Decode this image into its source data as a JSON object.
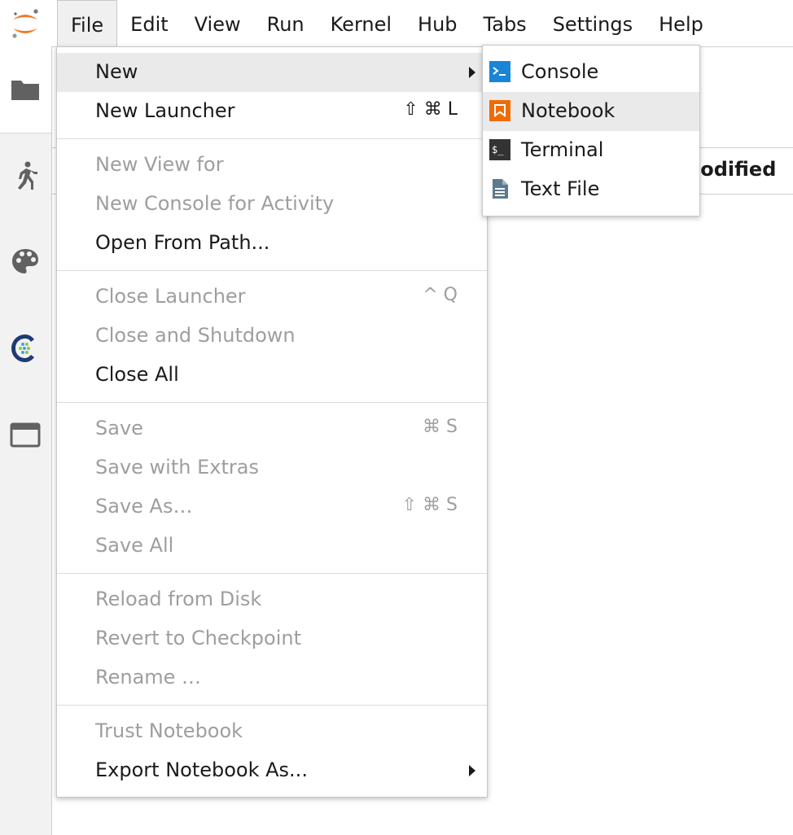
{
  "menubar": {
    "items": [
      "File",
      "Edit",
      "View",
      "Run",
      "Kernel",
      "Hub",
      "Tabs",
      "Settings",
      "Help"
    ],
    "active": "File"
  },
  "main": {
    "column_header": "lodified"
  },
  "file_menu": {
    "items": [
      {
        "label": "New",
        "submenu": true,
        "highlighted": true
      },
      {
        "label": "New Launcher",
        "shortcut": "⇧ ⌘ L"
      },
      {
        "label": "New View for",
        "disabled": true
      },
      {
        "label": "New Console for Activity",
        "disabled": true
      },
      {
        "label": "Open From Path..."
      },
      {
        "label": "Close Launcher",
        "shortcut": "^ Q",
        "disabled": true
      },
      {
        "label": "Close and Shutdown",
        "disabled": true
      },
      {
        "label": "Close All"
      },
      {
        "label": "Save",
        "shortcut": "⌘ S",
        "disabled": true
      },
      {
        "label": "Save with Extras",
        "disabled": true
      },
      {
        "label": "Save As…",
        "shortcut": "⇧ ⌘ S",
        "disabled": true
      },
      {
        "label": "Save All",
        "disabled": true
      },
      {
        "label": "Reload from Disk",
        "disabled": true
      },
      {
        "label": "Revert to Checkpoint",
        "disabled": true
      },
      {
        "label": "Rename …",
        "disabled": true
      },
      {
        "label": "Trust Notebook",
        "disabled": true
      },
      {
        "label": "Export Notebook As...",
        "submenu": true
      }
    ]
  },
  "new_submenu": {
    "items": [
      {
        "label": "Console",
        "icon": "console-icon",
        "color": "#1a85d6"
      },
      {
        "label": "Notebook",
        "icon": "notebook-icon",
        "color": "#ef6c00",
        "highlighted": true
      },
      {
        "label": "Terminal",
        "icon": "terminal-icon",
        "color": "#333333"
      },
      {
        "label": "Text File",
        "icon": "text-file-icon",
        "color": "#5e7a8e"
      }
    ]
  },
  "colors": {
    "jupyter_orange": "#f37726",
    "sidebar_icon": "#616161"
  }
}
